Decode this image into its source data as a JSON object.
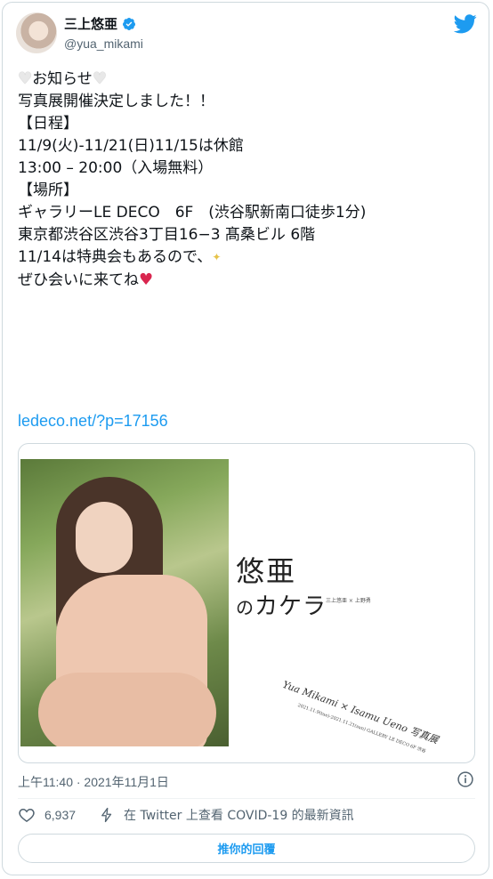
{
  "user": {
    "display_name": "三上悠亜",
    "handle": "@yua_mikami",
    "verified": true,
    "avatar_icon": "avatar"
  },
  "tweet": {
    "lines": [
      "お知らせ",
      "写真展開催決定しました！！",
      "【日程】",
      "11/9(火)-11/21(日)11/15は休館",
      "13:00 – 20:00（入場無料）",
      "【場所】",
      "ギャラリーLE DECO　6F　(渋谷駅新南口徒歩1分)",
      "東京都渋谷区渋谷3丁目16−3 髙桑ビル 6階",
      "11/14は特典会もあるので、",
      "ぜひ会いに来てね"
    ],
    "link": "ledeco.net/?p=17156"
  },
  "preview": {
    "title_main": "悠亜",
    "title_no": "の",
    "title_kana": "カケラ",
    "subtitle_small": "三上悠亜 × 上野勇",
    "credit_names": "Yua Mikami × Isamu Ueno 写真展",
    "credit_dates": "2021.11.9(tue)-2021.11.21(sun) GALLERY LE DECO 6F 渋谷"
  },
  "meta": {
    "timestamp": "上午11:40 · 2021年11月1日"
  },
  "actions": {
    "like_count": "6,937",
    "covid_label": "在 Twitter 上查看 COVID-19 的最新資訊",
    "reply_label": "推你的回覆"
  },
  "colors": {
    "accent": "#1d9bf0",
    "text": "#0f1419",
    "muted": "#536471",
    "heart_red": "#d9264f"
  }
}
